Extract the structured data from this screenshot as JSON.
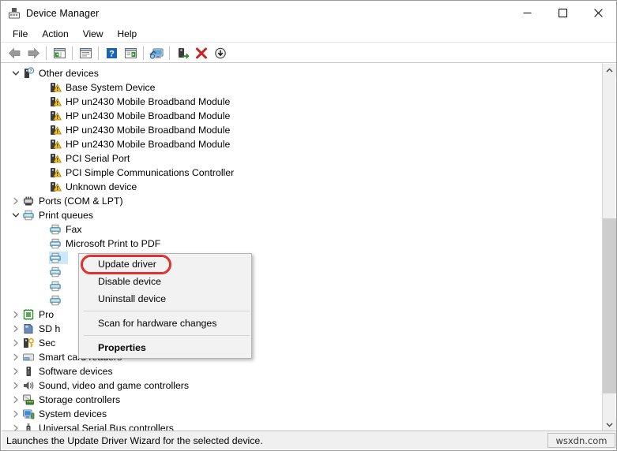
{
  "window": {
    "title": "Device Manager",
    "icon": "device-manager-icon",
    "controls": [
      {
        "name": "minimize-button",
        "glyph": "minimize"
      },
      {
        "name": "maximize-button",
        "glyph": "maximize"
      },
      {
        "name": "close-button",
        "glyph": "close"
      }
    ]
  },
  "menubar": {
    "items": [
      {
        "label": "File"
      },
      {
        "label": "Action"
      },
      {
        "label": "View"
      },
      {
        "label": "Help"
      }
    ]
  },
  "toolbar": {
    "buttons": [
      {
        "name": "back-button",
        "icon": "back-arrow-icon"
      },
      {
        "name": "forward-button",
        "icon": "forward-arrow-icon"
      },
      {
        "name": "separator-1",
        "icon": "separator"
      },
      {
        "name": "show-hide-console-tree-button",
        "icon": "console-tree-icon"
      },
      {
        "name": "separator-2",
        "icon": "separator"
      },
      {
        "name": "properties-button",
        "icon": "properties-window-icon"
      },
      {
        "name": "separator-3",
        "icon": "separator"
      },
      {
        "name": "help-button",
        "icon": "help-question-icon"
      },
      {
        "name": "action-menu-button",
        "icon": "action-list-icon"
      },
      {
        "name": "separator-4",
        "icon": "separator"
      },
      {
        "name": "scan-hardware-changes-button",
        "icon": "scan-monitor-icon"
      },
      {
        "name": "separator-5",
        "icon": "separator"
      },
      {
        "name": "update-driver-button",
        "icon": "update-driver-icon"
      },
      {
        "name": "uninstall-device-button",
        "icon": "red-x-icon"
      },
      {
        "name": "disable-device-button",
        "icon": "down-arrow-circle-icon"
      }
    ]
  },
  "tree": {
    "rows": [
      {
        "depth": 0,
        "twisty": "expanded",
        "icon": "other-devices-icon",
        "label": "Other devices",
        "selected": false
      },
      {
        "depth": 1,
        "twisty": "none",
        "icon": "warning-device-icon",
        "label": "Base System Device",
        "selected": false
      },
      {
        "depth": 1,
        "twisty": "none",
        "icon": "warning-device-icon",
        "label": "HP un2430 Mobile Broadband Module",
        "selected": false
      },
      {
        "depth": 1,
        "twisty": "none",
        "icon": "warning-device-icon",
        "label": "HP un2430 Mobile Broadband Module",
        "selected": false
      },
      {
        "depth": 1,
        "twisty": "none",
        "icon": "warning-device-icon",
        "label": "HP un2430 Mobile Broadband Module",
        "selected": false
      },
      {
        "depth": 1,
        "twisty": "none",
        "icon": "warning-device-icon",
        "label": "HP un2430 Mobile Broadband Module",
        "selected": false
      },
      {
        "depth": 1,
        "twisty": "none",
        "icon": "warning-device-icon",
        "label": "PCI Serial Port",
        "selected": false
      },
      {
        "depth": 1,
        "twisty": "none",
        "icon": "warning-device-icon",
        "label": "PCI Simple Communications Controller",
        "selected": false
      },
      {
        "depth": 1,
        "twisty": "none",
        "icon": "warning-device-icon",
        "label": "Unknown device",
        "selected": false
      },
      {
        "depth": 0,
        "twisty": "collapsed",
        "icon": "ports-icon",
        "label": "Ports (COM & LPT)",
        "selected": false
      },
      {
        "depth": 0,
        "twisty": "expanded",
        "icon": "printer-icon",
        "label": "Print queues",
        "selected": false
      },
      {
        "depth": 1,
        "twisty": "none",
        "icon": "printer-icon",
        "label": "Fax",
        "selected": false
      },
      {
        "depth": 1,
        "twisty": "none",
        "icon": "printer-icon",
        "label": "Microsoft Print to PDF",
        "selected": false
      },
      {
        "depth": 1,
        "twisty": "none",
        "icon": "printer-icon",
        "label": "",
        "selected": true
      },
      {
        "depth": 1,
        "twisty": "none",
        "icon": "printer-icon",
        "label": "",
        "selected": false
      },
      {
        "depth": 1,
        "twisty": "none",
        "icon": "printer-icon",
        "label": "",
        "selected": false
      },
      {
        "depth": 1,
        "twisty": "none",
        "icon": "printer-icon",
        "label": "",
        "selected": false
      },
      {
        "depth": 0,
        "twisty": "collapsed",
        "icon": "processor-icon",
        "label": "Pro",
        "selected": false
      },
      {
        "depth": 0,
        "twisty": "collapsed",
        "icon": "sd-host-icon",
        "label": "SD h",
        "selected": false
      },
      {
        "depth": 0,
        "twisty": "collapsed",
        "icon": "security-device-icon",
        "label": "Sec",
        "selected": false
      },
      {
        "depth": 0,
        "twisty": "collapsed",
        "icon": "smart-card-reader-icon",
        "label": "Smart card readers",
        "selected": false
      },
      {
        "depth": 0,
        "twisty": "collapsed",
        "icon": "software-device-icon",
        "label": "Software devices",
        "selected": false
      },
      {
        "depth": 0,
        "twisty": "collapsed",
        "icon": "sound-device-icon",
        "label": "Sound, video and game controllers",
        "selected": false
      },
      {
        "depth": 0,
        "twisty": "collapsed",
        "icon": "storage-controller-icon",
        "label": "Storage controllers",
        "selected": false
      },
      {
        "depth": 0,
        "twisty": "collapsed",
        "icon": "system-device-icon",
        "label": "System devices",
        "selected": false
      },
      {
        "depth": 0,
        "twisty": "collapsed",
        "icon": "usb-controller-icon",
        "label": "Universal Serial Bus controllers",
        "selected": false
      }
    ]
  },
  "context_menu": {
    "highlighted_item": "Update driver",
    "highlight_color": "#e03030",
    "items": [
      {
        "label": "Update driver",
        "type": "item",
        "bold": false
      },
      {
        "label": "Disable device",
        "type": "item",
        "bold": false
      },
      {
        "label": "Uninstall device",
        "type": "item",
        "bold": false
      },
      {
        "label": "",
        "type": "separator",
        "bold": false
      },
      {
        "label": "Scan for hardware changes",
        "type": "item",
        "bold": false
      },
      {
        "label": "",
        "type": "separator",
        "bold": false
      },
      {
        "label": "Properties",
        "type": "item",
        "bold": true
      }
    ]
  },
  "statusbar": {
    "text": "Launches the Update Driver Wizard for the selected device.",
    "watermark": "wsxdn.com"
  },
  "scrollbar": {
    "up_arrow": "chevron-up-icon",
    "down_arrow": "chevron-down-icon"
  }
}
